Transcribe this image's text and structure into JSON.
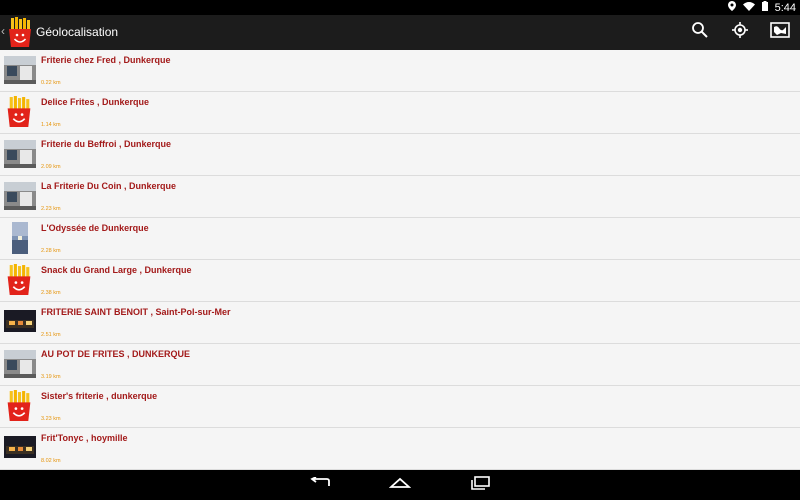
{
  "status_bar": {
    "time": "5:44"
  },
  "action_bar": {
    "title": "Géolocalisation",
    "icons": [
      "up-chevron-icon",
      "fries-logo-icon",
      "search-icon",
      "my-location-icon",
      "map-view-icon"
    ]
  },
  "list": [
    {
      "title": "Friterie chez Fred , Dunkerque",
      "distance": "0.22 km",
      "thumb": "photo-storefront"
    },
    {
      "title": "Delice Frites , Dunkerque",
      "distance": "1.14 km",
      "thumb": "fries-logo"
    },
    {
      "title": "Friterie du Beffroi , Dunkerque",
      "distance": "2.09 km",
      "thumb": "photo-storefront"
    },
    {
      "title": "La Friterie Du Coin , Dunkerque",
      "distance": "2.23 km",
      "thumb": "photo-storefront"
    },
    {
      "title": "L'Odyssée de Dunkerque",
      "distance": "2.28 km",
      "thumb": "photo-sea"
    },
    {
      "title": "Snack du Grand Large , Dunkerque",
      "distance": "2.38 km",
      "thumb": "fries-logo"
    },
    {
      "title": "FRITERIE SAINT BENOIT , Saint-Pol-sur-Mer",
      "distance": "2.51 km",
      "thumb": "photo-night"
    },
    {
      "title": "AU POT DE FRITES , DUNKERQUE",
      "distance": "3.19 km",
      "thumb": "photo-storefront"
    },
    {
      "title": "Sister's friterie , dunkerque",
      "distance": "3.23 km",
      "thumb": "fries-logo"
    },
    {
      "title": "Frit'Tonyc , hoymille",
      "distance": "8.02 km",
      "thumb": "photo-night"
    }
  ],
  "nav_bar": {
    "icons": [
      "back-icon",
      "home-icon",
      "recents-icon"
    ]
  },
  "colors": {
    "title_red": "#a31a1a",
    "distance_orange": "#e6950c",
    "action_bar": "#1c1c1c",
    "list_bg": "#f5f5f5"
  }
}
